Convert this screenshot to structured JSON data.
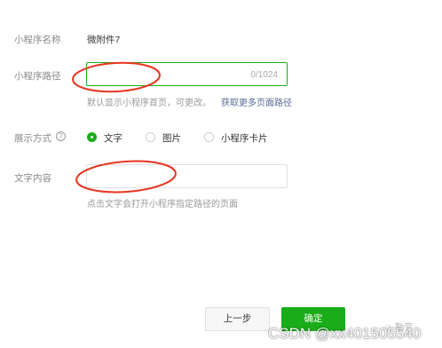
{
  "form": {
    "name_label": "小程序名称",
    "name_value": "微附件7",
    "path_label": "小程序路径",
    "path_counter": "0/1024",
    "path_hint": "默认显示小程序首页，可更改。",
    "path_link": "获取更多页面路径",
    "display_label": "展示方式",
    "help_glyph": "?",
    "options": [
      {
        "label": "文字",
        "checked": true
      },
      {
        "label": "图片",
        "checked": false
      },
      {
        "label": "小程序卡片",
        "checked": false
      }
    ],
    "text_label": "文字内容",
    "text_hint": "点击文字会打开小程序指定路径的页面"
  },
  "footer": {
    "prev_label": "上一步",
    "confirm_label": "确定"
  },
  "watermark": {
    "text": "CSDN @xx401505540",
    "faint": "☺ 勤劳"
  },
  "colors": {
    "primary": "#1aad19",
    "link": "#576b95",
    "annotation": "#e8341f"
  }
}
